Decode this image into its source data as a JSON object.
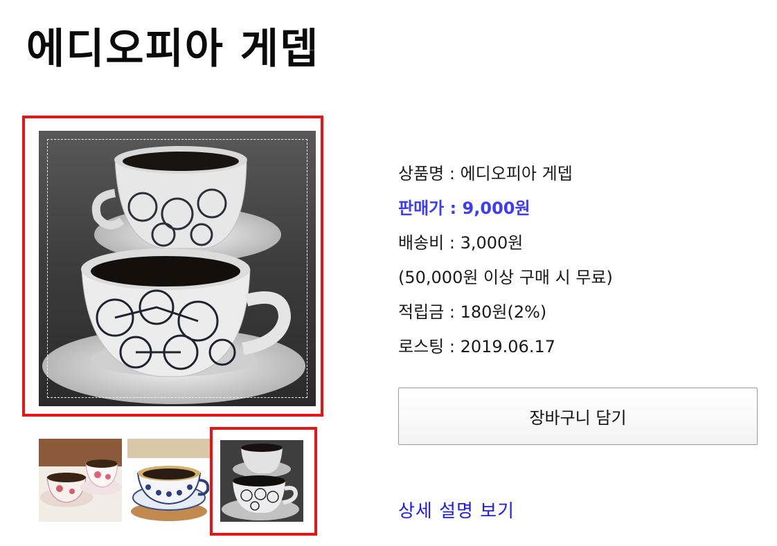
{
  "product": {
    "title": "에디오피아 게뎁"
  },
  "info": {
    "name": "상품명 : 에디오피아 게뎁",
    "price": "판매가 : 9,000원",
    "shipping": "배송비 : 3,000원",
    "shipping_note": "(50,000원 이상 구매 시 무료)",
    "points": "적립금 : 180원(2%)",
    "roasting": "로스팅 : 2019.06.17"
  },
  "actions": {
    "cart_label": "장바구니 담기",
    "detail_link": "상세 설명 보기"
  },
  "colors": {
    "selection_border": "#ee1111",
    "price": "#3b3bff",
    "link": "#1a1aff"
  }
}
